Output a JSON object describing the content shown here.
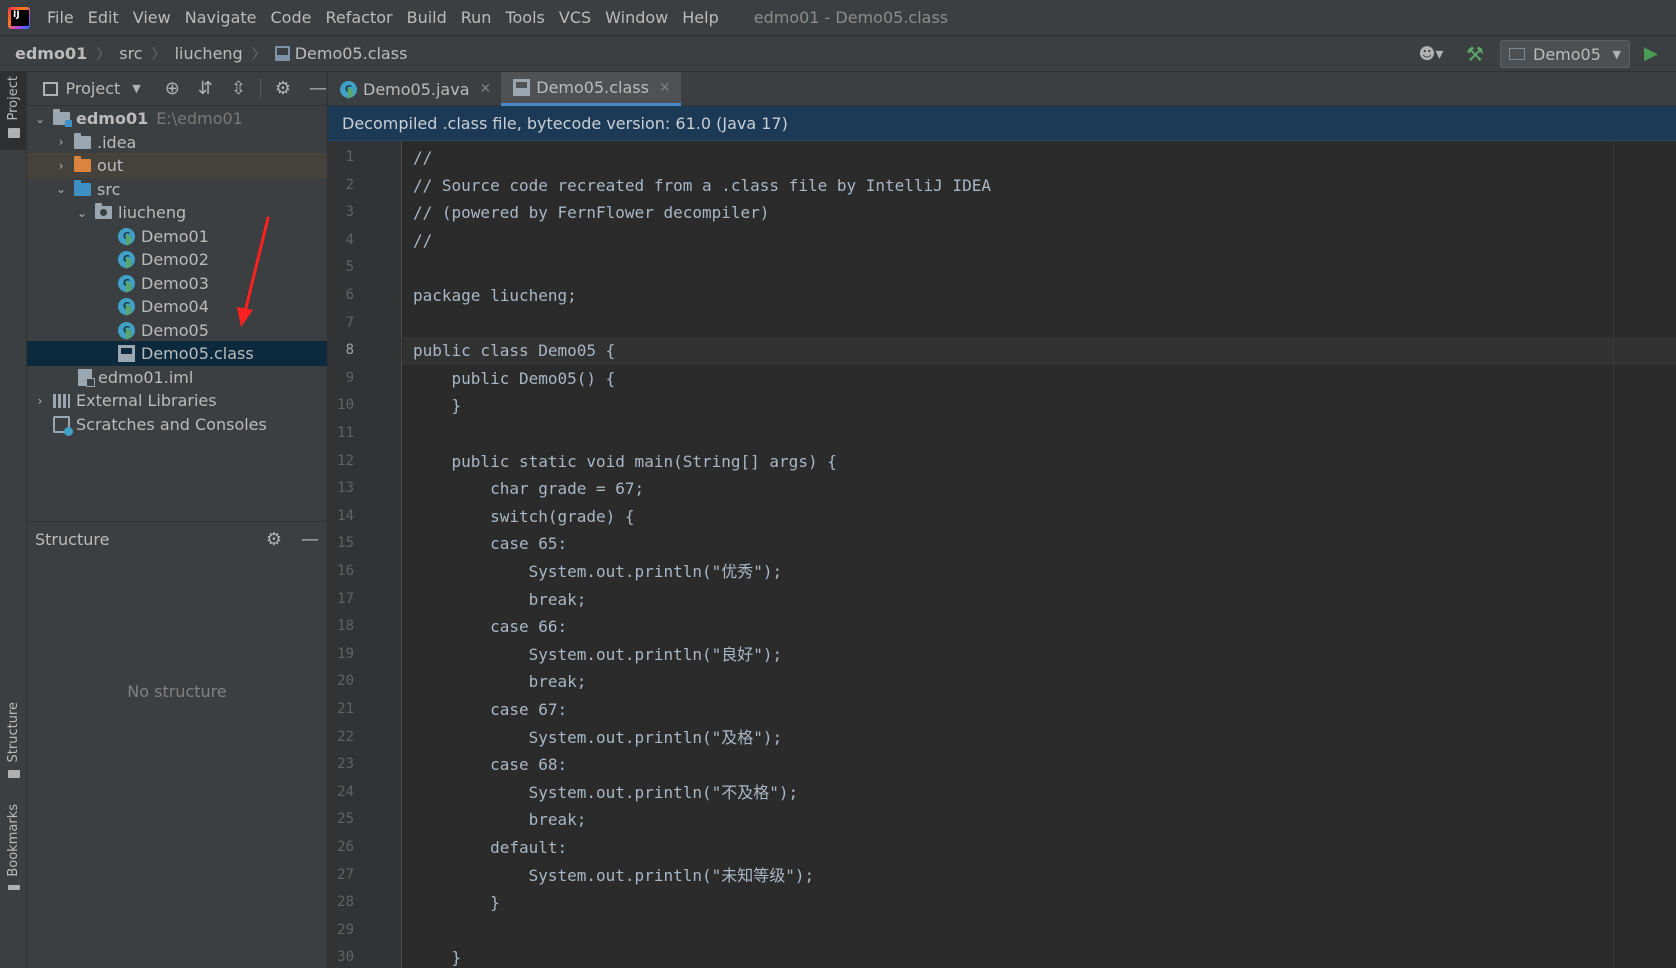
{
  "menu": {
    "items": [
      "File",
      "Edit",
      "View",
      "Navigate",
      "Code",
      "Refactor",
      "Build",
      "Run",
      "Tools",
      "VCS",
      "Window",
      "Help"
    ],
    "window_title": "edmo01 - Demo05.class"
  },
  "breadcrumb": {
    "items": [
      "edmo01",
      "src",
      "liucheng",
      "Demo05.class"
    ]
  },
  "toolbar": {
    "run_config": "Demo05"
  },
  "left_strip": {
    "project_label": "Project",
    "structure_label": "Structure",
    "bookmarks_label": "Bookmarks"
  },
  "project_panel": {
    "title": "Project",
    "tree": [
      {
        "label": "edmo01",
        "hint": "E:\\edmo01"
      },
      {
        "label": ".idea"
      },
      {
        "label": "out"
      },
      {
        "label": "src"
      },
      {
        "label": "liucheng"
      },
      {
        "label": "Demo01"
      },
      {
        "label": "Demo02"
      },
      {
        "label": "Demo03"
      },
      {
        "label": "Demo04"
      },
      {
        "label": "Demo05"
      },
      {
        "label": "Demo05.class"
      },
      {
        "label": "edmo01.iml"
      },
      {
        "label": "External Libraries"
      },
      {
        "label": "Scratches and Consoles"
      }
    ]
  },
  "structure_panel": {
    "title": "Structure",
    "empty_text": "No structure"
  },
  "editor": {
    "tabs": [
      {
        "label": "Demo05.java"
      },
      {
        "label": "Demo05.class"
      }
    ],
    "banner": "Decompiled .class file, bytecode version: 61.0 (Java 17)",
    "current_line": 8,
    "line_numbers": [
      "1",
      "2",
      "3",
      "4",
      "5",
      "6",
      "7",
      "8",
      "9",
      "10",
      "11",
      "12",
      "13",
      "14",
      "15",
      "16",
      "17",
      "18",
      "19",
      "20",
      "21",
      "22",
      "23",
      "24",
      "25",
      "26",
      "27",
      "28",
      "29",
      "30"
    ],
    "lines": [
      "//",
      "// Source code recreated from a .class file by IntelliJ IDEA",
      "// (powered by FernFlower decompiler)",
      "//",
      "",
      "package liucheng;",
      "",
      "public class Demo05 {",
      "    public Demo05() {",
      "    }",
      "",
      "    public static void main(String[] args) {",
      "        char grade = 67;",
      "        switch(grade) {",
      "        case 65:",
      "            System.out.println(\"优秀\");",
      "            break;",
      "        case 66:",
      "            System.out.println(\"良好\");",
      "            break;",
      "        case 67:",
      "            System.out.println(\"及格\");",
      "        case 68:",
      "            System.out.println(\"不及格\");",
      "            break;",
      "        default:",
      "            System.out.println(\"未知等级\");",
      "        }",
      "",
      "    }"
    ]
  },
  "colors": {
    "menu_bg": "#3c3f41",
    "editor_bg": "#2b2b2b",
    "banner_bg": "#1c3a56",
    "selection_bg": "#0d293e",
    "tab_underline": "#4a88c7",
    "arrow": "#ff2020"
  }
}
